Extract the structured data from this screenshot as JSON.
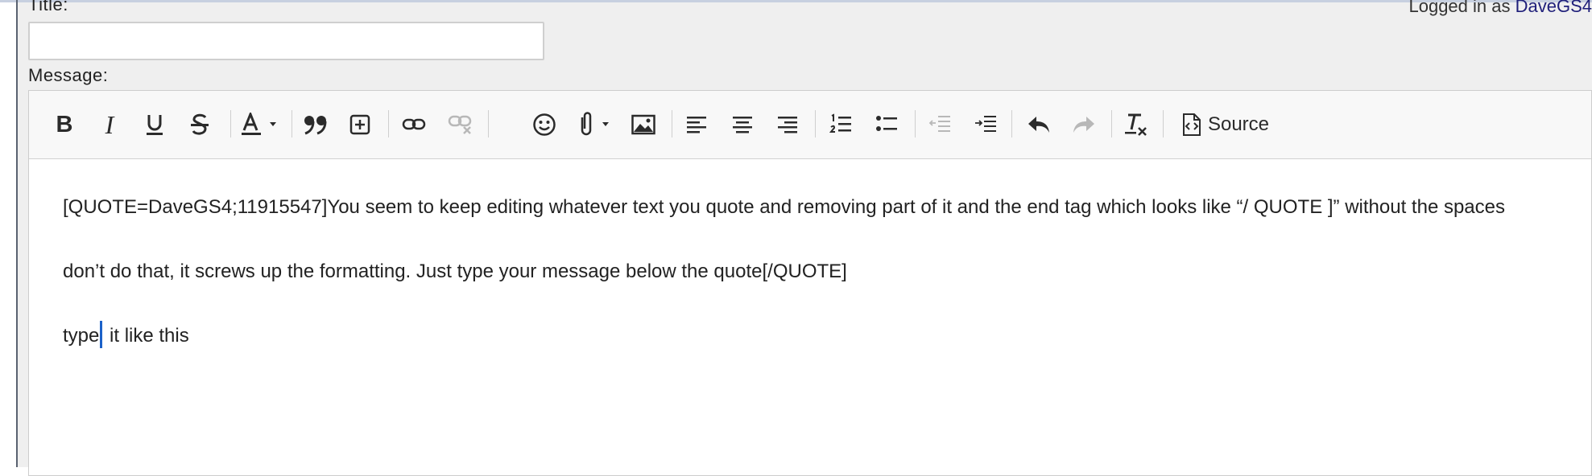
{
  "header": {
    "title_label": "Title:",
    "logged_in_prefix": "Logged in as",
    "logged_in_user": "DaveGS4"
  },
  "title_input": {
    "value": "",
    "placeholder": ""
  },
  "message_label": "Message:",
  "toolbar": {
    "bold_glyph": "B",
    "italic_glyph": "I",
    "source_label": "Source",
    "buttons": [
      "bold",
      "italic",
      "underline",
      "strikethrough",
      "text-color",
      "blockquote",
      "insert-table",
      "link",
      "unlink",
      "emoji",
      "attachment",
      "image",
      "align-left",
      "align-center",
      "align-right",
      "numbered-list",
      "bulleted-list",
      "outdent",
      "indent",
      "undo",
      "redo",
      "remove-format",
      "source"
    ],
    "disabled": [
      "unlink",
      "outdent",
      "redo"
    ]
  },
  "editor": {
    "paragraph_1": "[QUOTE=DaveGS4;11915547]You seem to keep editing whatever text you quote and removing part of it and the end tag which looks like “/ QUOTE ]” without the spaces",
    "paragraph_2": "don’t do that, it screws up the formatting. Just type your message below the quote[/QUOTE]",
    "paragraph_3_before_caret": "type",
    "paragraph_3_after_caret": " it like this"
  },
  "colors": {
    "panel_bg": "#efefef",
    "toolbar_bg": "#f8f8f8",
    "caret": "#1b61c9",
    "username_link": "#1f1f7a",
    "disabled_icon": "#b8b8b8"
  }
}
